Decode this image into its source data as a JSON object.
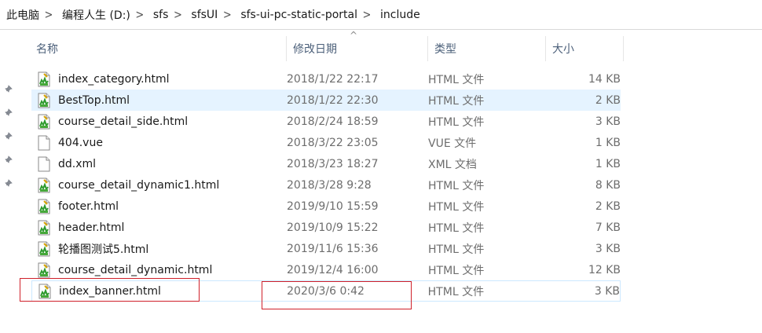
{
  "breadcrumb": [
    "此电脑",
    "编程人生 (D:)",
    "sfs",
    "sfsUI",
    "sfs-ui-pc-static-portal",
    "include"
  ],
  "columns": {
    "name": "名称",
    "date": "修改日期",
    "type": "类型",
    "size": "大小"
  },
  "sort_indicator": "^",
  "files": [
    {
      "name": "index_category.html",
      "date": "2018/1/22 22:17",
      "type": "HTML 文件",
      "size": "14 KB",
      "icon": "html-file-icon"
    },
    {
      "name": "BestTop.html",
      "date": "2018/1/22 22:30",
      "type": "HTML 文件",
      "size": "2 KB",
      "icon": "html-file-icon"
    },
    {
      "name": "course_detail_side.html",
      "date": "2018/2/24 18:59",
      "type": "HTML 文件",
      "size": "3 KB",
      "icon": "html-file-icon"
    },
    {
      "name": "404.vue",
      "date": "2018/3/22 23:05",
      "type": "VUE 文件",
      "size": "1 KB",
      "icon": "blank-file-icon"
    },
    {
      "name": "dd.xml",
      "date": "2018/3/23 18:27",
      "type": "XML 文档",
      "size": "1 KB",
      "icon": "blank-file-icon"
    },
    {
      "name": "course_detail_dynamic1.html",
      "date": "2018/3/28 9:28",
      "type": "HTML 文件",
      "size": "8 KB",
      "icon": "html-file-icon"
    },
    {
      "name": "footer.html",
      "date": "2019/9/10 15:59",
      "type": "HTML 文件",
      "size": "2 KB",
      "icon": "html-file-icon"
    },
    {
      "name": "header.html",
      "date": "2019/10/9 15:22",
      "type": "HTML 文件",
      "size": "7 KB",
      "icon": "html-file-icon"
    },
    {
      "name": "轮播图测试5.html",
      "date": "2019/11/6 15:36",
      "type": "HTML 文件",
      "size": "3 KB",
      "icon": "html-file-icon"
    },
    {
      "name": "course_detail_dynamic.html",
      "date": "2019/12/4 16:00",
      "type": "HTML 文件",
      "size": "12 KB",
      "icon": "html-file-icon"
    },
    {
      "name": "index_banner.html",
      "date": "2020/3/6 0:42",
      "type": "HTML 文件",
      "size": "3 KB",
      "icon": "html-file-icon"
    }
  ],
  "selected_row": "BestTop.html",
  "focused_row": "index_banner.html",
  "pin_icon": "pin-icon",
  "annotation_color": "#d0202a",
  "selection_color": "#e5f3ff"
}
